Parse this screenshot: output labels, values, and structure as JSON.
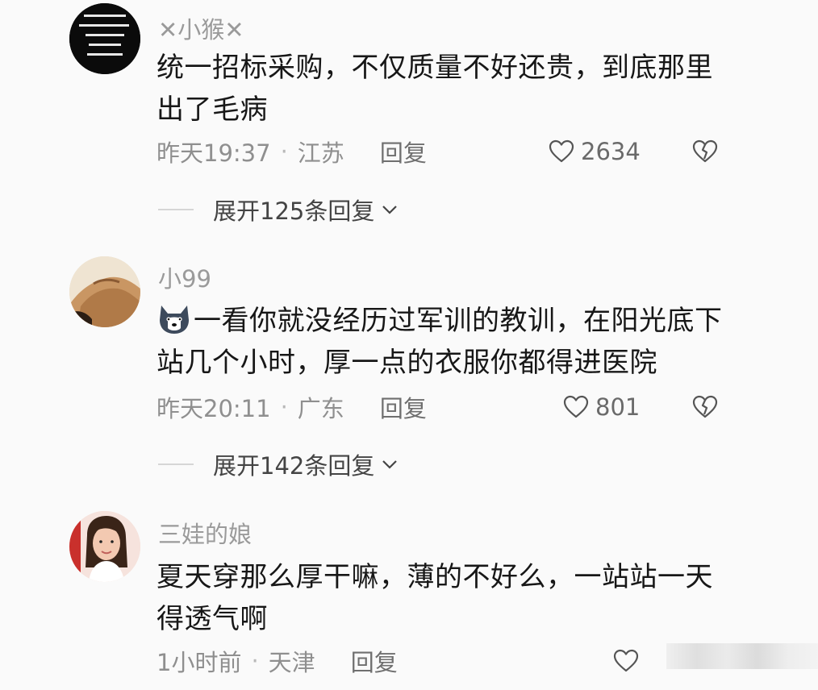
{
  "comments": [
    {
      "username": "✕小猴✕",
      "text": "统一招标采购，不仅质量不好还贵，到底那里出了毛病",
      "time": "昨天19:37",
      "location": "江苏",
      "reply_label": "回复",
      "likes": "2634",
      "expand_label": "展开125条回复",
      "avatar_icon": "text-avatar-icon"
    },
    {
      "username": "小99",
      "emoji_icon": "husky-emoji-icon",
      "text": "一看你就没经历过军训的教训，在阳光底下站几个小时，厚一点的衣服你都得进医院",
      "time": "昨天20:11",
      "location": "广东",
      "reply_label": "回复",
      "likes": "801",
      "expand_label": "展开142条回复",
      "avatar_icon": "cat-avatar-icon"
    },
    {
      "username": "三娃的娘",
      "text": "夏天穿那么厚干嘛，薄的不好么，一站站一天得透气啊",
      "time": "1小时前",
      "location": "天津",
      "reply_label": "回复",
      "likes": "",
      "avatar_icon": "woman-avatar-icon"
    }
  ],
  "colors": {
    "text": "#171717",
    "meta": "#8f8f8f",
    "username": "#9a9a9a"
  }
}
